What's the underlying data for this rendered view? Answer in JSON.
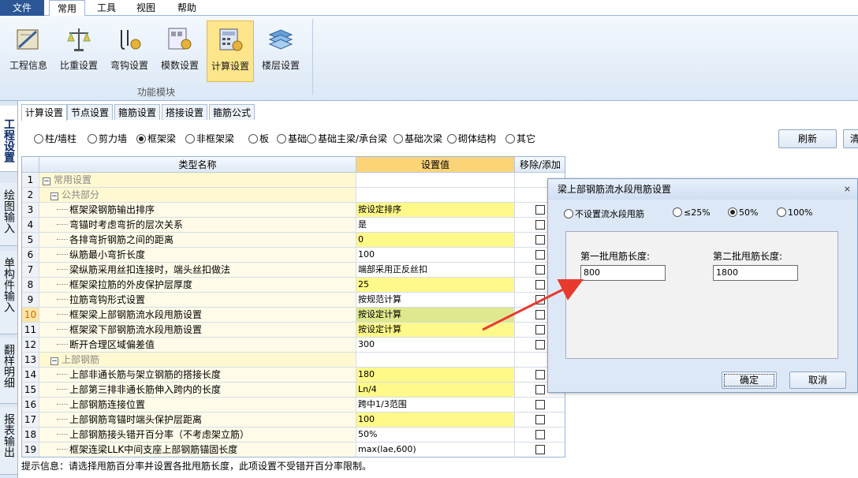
{
  "menu": {
    "file": "文件",
    "common": "常用",
    "tools": "工具",
    "view": "视图",
    "help": "帮助"
  },
  "ribbon": {
    "buttons": [
      "工程信息",
      "比重设置",
      "弯钩设置",
      "模数设置",
      "计算设置",
      "楼层设置"
    ],
    "group_label": "功能模块"
  },
  "side_tabs": [
    "工程设置",
    "绘图输入",
    "单构件输入",
    "翻样明细",
    "报表输出"
  ],
  "sub_tabs": [
    "计算设置",
    "节点设置",
    "箍筋设置",
    "搭接设置",
    "箍筋公式"
  ],
  "categories": {
    "options": [
      "柱/墙柱",
      "剪力墙",
      "框架梁",
      "非框架梁",
      "板",
      "基础",
      "基础主梁/承台梁",
      "基础次梁",
      "砌体结构",
      "其它"
    ],
    "selected": "框架梁"
  },
  "buttons": {
    "refresh": "刷新",
    "clear": "清"
  },
  "grid": {
    "headers": {
      "name": "类型名称",
      "value": "设置值",
      "action": "移除/添加"
    },
    "rows": [
      {
        "num": "1",
        "name": "常用设置",
        "value": "",
        "level": 0,
        "check": false
      },
      {
        "num": "2",
        "name": "公共部分",
        "value": "",
        "level": 1,
        "check": false
      },
      {
        "num": "3",
        "name": "框架梁钢筋输出排序",
        "value": "按设定排序",
        "level": 2,
        "check": true,
        "hl": true
      },
      {
        "num": "4",
        "name": "弯锚时考虑弯折的层次关系",
        "value": "是",
        "level": 2,
        "check": true,
        "hl": false
      },
      {
        "num": "5",
        "name": "各排弯折钢筋之间的距离",
        "value": "0",
        "level": 2,
        "check": true,
        "hl": true
      },
      {
        "num": "6",
        "name": "纵筋最小弯折长度",
        "value": "100",
        "level": 2,
        "check": true,
        "hl": false
      },
      {
        "num": "7",
        "name": "梁纵筋采用丝扣连接时，端头丝扣做法",
        "value": "端部采用正反丝扣",
        "level": 2,
        "check": true,
        "hl": false
      },
      {
        "num": "8",
        "name": "框架梁拉筋的外皮保护层厚度",
        "value": "25",
        "level": 2,
        "check": true,
        "hl": true
      },
      {
        "num": "9",
        "name": "拉筋弯钩形式设置",
        "value": "按规范计算",
        "level": 2,
        "check": true,
        "hl": false
      },
      {
        "num": "10",
        "name": "框架梁上部钢筋流水段甩筋设置",
        "value": "按设定计算",
        "level": 2,
        "check": true,
        "hl": true,
        "sel": true
      },
      {
        "num": "11",
        "name": "框架梁下部钢筋流水段甩筋设置",
        "value": "按设定计算",
        "level": 2,
        "check": true,
        "hl": true
      },
      {
        "num": "12",
        "name": "断开合理区域偏差值",
        "value": "300",
        "level": 2,
        "check": true,
        "hl": false
      },
      {
        "num": "13",
        "name": "上部钢筋",
        "value": "",
        "level": 1,
        "check": false
      },
      {
        "num": "14",
        "name": "上部非通长筋与架立钢筋的搭接长度",
        "value": "180",
        "level": 2,
        "check": true,
        "hl": true
      },
      {
        "num": "15",
        "name": "上部第三排非通长筋伸入跨内的长度",
        "value": "Ln/4",
        "level": 2,
        "check": true,
        "hl": true
      },
      {
        "num": "16",
        "name": "上部钢筋连接位置",
        "value": "跨中1/3范围",
        "level": 2,
        "check": true,
        "hl": false
      },
      {
        "num": "17",
        "name": "上部钢筋弯锚时端头保护层距离",
        "value": "100",
        "level": 2,
        "check": true,
        "hl": true
      },
      {
        "num": "18",
        "name": "上部钢筋接头错开百分率（不考虑架立筋）",
        "value": "50%",
        "level": 2,
        "check": true,
        "hl": false
      },
      {
        "num": "19",
        "name": "框架连梁LLK中间支座上部钢筋锚固长度",
        "value": "max(lae,600)",
        "level": 2,
        "check": true,
        "hl": false
      }
    ]
  },
  "status": "提示信息：请选择甩筋百分率并设置各批甩筋长度，此项设置不受错开百分率限制。",
  "dialog": {
    "title": "梁上部钢筋流水段甩筋设置",
    "options": [
      "不设置流水段甩筋",
      "≤25%",
      "50%",
      "100%"
    ],
    "selected": "50%",
    "first_label": "第一批甩筋长度:",
    "first_value": "800",
    "second_label": "第二批甩筋长度:",
    "second_value": "1800",
    "ok": "确定",
    "cancel": "取消"
  }
}
